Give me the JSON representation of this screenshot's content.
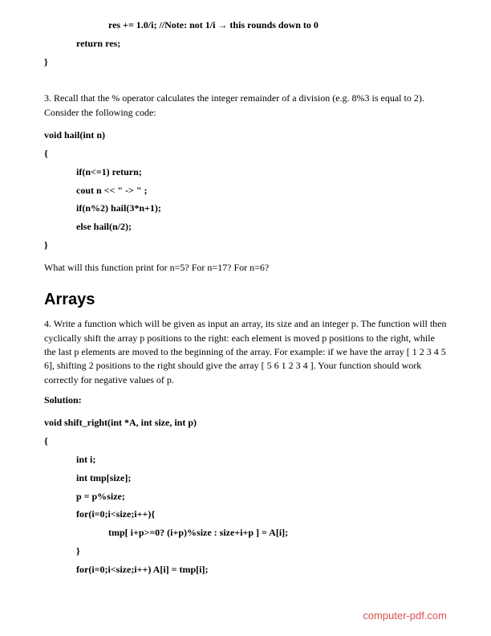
{
  "code1": {
    "l1": "res += 1.0/i; //Note: not 1/i → this rounds down to 0",
    "l2": "return res;",
    "l3": "}"
  },
  "para1": "3. Recall that the % operator calculates the integer remainder of a division (e.g. 8%3 is equal to 2). Consider the following code:",
  "code2": {
    "l1": "void hail(int n)",
    "l2": "{",
    "l3": "if(n<=1) return;",
    "l4": "cout n << \" -> \" ;",
    "l5": "if(n%2) hail(3*n+1);",
    "l6": "else hail(n/2);",
    "l7": "}"
  },
  "para2": "What will this function print for n=5? For n=17? For n=6?",
  "heading": "Arrays",
  "para3": "4. Write a function which will be given as input an array, its size and an integer p. The function will then cyclically shift the array p positions to the right: each element is moved p positions to the right, while the last p elements are moved to the beginning of the array. For example: if we have the array [ 1 2 3 4 5 6], shifting 2 positions to the right should give the array [ 5 6 1 2 3 4 ]. Your function should work correctly for negative values of p.",
  "sol_label": "Solution:",
  "code3": {
    "l1": "void shift_right(int *A, int size, int p)",
    "l2": "{",
    "l3": "int i;",
    "l4": "int tmp[size];",
    "l5": "p = p%size;",
    "l6": "for(i=0;i<size;i++){",
    "l7": "tmp[ i+p>=0? (i+p)%size : size+i+p ] = A[i];",
    "l8": "}",
    "l9": "for(i=0;i<size;i++) A[i] = tmp[i];"
  },
  "footer": "computer-pdf.com"
}
